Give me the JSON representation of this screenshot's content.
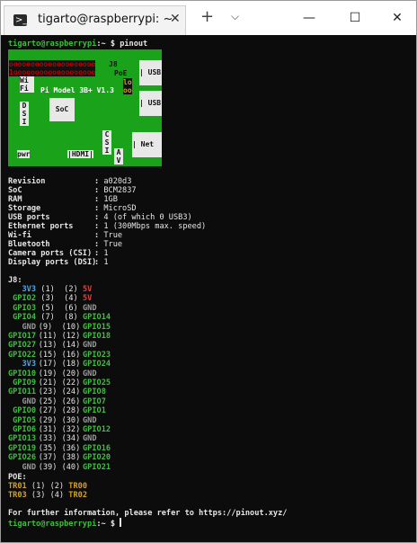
{
  "window": {
    "tab_title": "tigarto@raspberrypi: ~",
    "tab_icon": ">_",
    "tab_close": "✕",
    "new_tab": "+",
    "dropdown": "⌵",
    "minimize": "—",
    "maximize": "☐",
    "close": "✕"
  },
  "prompt": {
    "user_host": "tigarto@raspberrypi",
    "path": ":~ $",
    "command": " pinout"
  },
  "board": {
    "pins_top": "oooooooooooooooooooo",
    "pins_bottom": "1ooooooooooooooooooo",
    "j8": "J8",
    "poe": "PoE",
    "usb1": "| USB",
    "usb2": "| USB",
    "net": "| Net",
    "wifi": "Wi\nFi",
    "model": "Pi Model 3B+ V1.3",
    "poe_pins_1": "lo",
    "poe_pins_2": "oo",
    "soc": "SoC",
    "dsi": "D\nS\nI",
    "csi": "C\nS\nI",
    "av": "A\nV",
    "pwr": "pwr",
    "hdmi": "|HDMI|"
  },
  "specs": [
    {
      "label": "Revision",
      "value": "a020d3"
    },
    {
      "label": "SoC",
      "value": "BCM2837"
    },
    {
      "label": "RAM",
      "value": "1GB"
    },
    {
      "label": "Storage",
      "value": "MicroSD"
    },
    {
      "label": "USB ports",
      "value": "4 (of which 0 USB3)"
    },
    {
      "label": "Ethernet ports",
      "value": "1 (300Mbps max. speed)"
    },
    {
      "label": "Wi-fi",
      "value": "True"
    },
    {
      "label": "Bluetooth",
      "value": "True"
    },
    {
      "label": "Camera ports (CSI)",
      "value": "1"
    },
    {
      "label": "Display ports (DSI)",
      "value": "1"
    }
  ],
  "j8_header": "J8:",
  "j8_rows": [
    {
      "left": "3V3",
      "lc": "b",
      "mid": "(1)  (2)",
      "right": "5V",
      "rc": "r"
    },
    {
      "left": "GPIO2",
      "lc": "g",
      "mid": "(3)  (4)",
      "right": "5V",
      "rc": "r"
    },
    {
      "left": "GPIO3",
      "lc": "g",
      "mid": "(5)  (6)",
      "right": "GND",
      "rc": "gr"
    },
    {
      "left": "GPIO4",
      "lc": "g",
      "mid": "(7)  (8)",
      "right": "GPIO14",
      "rc": "g"
    },
    {
      "left": "GND",
      "lc": "gr",
      "mid": "(9)  (10)",
      "right": "GPIO15",
      "rc": "g"
    },
    {
      "left": "GPIO17",
      "lc": "g",
      "mid": "(11) (12)",
      "right": "GPIO18",
      "rc": "g"
    },
    {
      "left": "GPIO27",
      "lc": "g",
      "mid": "(13) (14)",
      "right": "GND",
      "rc": "gr"
    },
    {
      "left": "GPIO22",
      "lc": "g",
      "mid": "(15) (16)",
      "right": "GPIO23",
      "rc": "g"
    },
    {
      "left": "3V3",
      "lc": "b",
      "mid": "(17) (18)",
      "right": "GPIO24",
      "rc": "g"
    },
    {
      "left": "GPIO10",
      "lc": "g",
      "mid": "(19) (20)",
      "right": "GND",
      "rc": "gr"
    },
    {
      "left": "GPIO9",
      "lc": "g",
      "mid": "(21) (22)",
      "right": "GPIO25",
      "rc": "g"
    },
    {
      "left": "GPIO11",
      "lc": "g",
      "mid": "(23) (24)",
      "right": "GPIO8",
      "rc": "g"
    },
    {
      "left": "GND",
      "lc": "gr",
      "mid": "(25) (26)",
      "right": "GPIO7",
      "rc": "g"
    },
    {
      "left": "GPIO0",
      "lc": "g",
      "mid": "(27) (28)",
      "right": "GPIO1",
      "rc": "g"
    },
    {
      "left": "GPIO5",
      "lc": "g",
      "mid": "(29) (30)",
      "right": "GND",
      "rc": "gr"
    },
    {
      "left": "GPIO6",
      "lc": "g",
      "mid": "(31) (32)",
      "right": "GPIO12",
      "rc": "g"
    },
    {
      "left": "GPIO13",
      "lc": "g",
      "mid": "(33) (34)",
      "right": "GND",
      "rc": "gr"
    },
    {
      "left": "GPIO19",
      "lc": "g",
      "mid": "(35) (36)",
      "right": "GPIO16",
      "rc": "g"
    },
    {
      "left": "GPIO26",
      "lc": "g",
      "mid": "(37) (38)",
      "right": "GPIO20",
      "rc": "g"
    },
    {
      "left": "GND",
      "lc": "gr",
      "mid": "(39) (40)",
      "right": "GPIO21",
      "rc": "g"
    }
  ],
  "poe_header": "POE:",
  "poe_rows": [
    {
      "left": "TR01",
      "mid": "(1) (2)",
      "right": "TR00"
    },
    {
      "left": "TR03",
      "mid": "(3) (4)",
      "right": "TR02"
    }
  ],
  "footer": "For further information, please refer to https://pinout.xyz/",
  "final_prompt": {
    "user_host": "tigarto@raspberrypi",
    "path": ":~ $"
  }
}
